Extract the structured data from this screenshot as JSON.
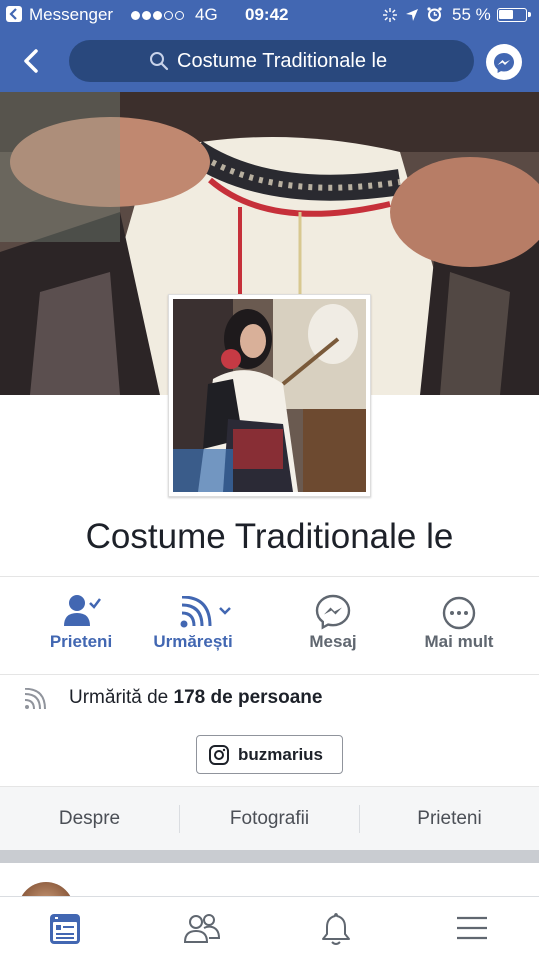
{
  "status_bar": {
    "carrier": "Messenger",
    "network": "4G",
    "time": "09:42",
    "battery_percent": "55 %",
    "signal_bars_filled": 3,
    "signal_bars_total": 5,
    "battery_level": 0.55
  },
  "nav": {
    "search_text": "Costume Traditionale le"
  },
  "page": {
    "name": "Costume Traditionale le"
  },
  "actions": [
    {
      "label": "Prieteni",
      "icon": "friends-check-icon",
      "active": true
    },
    {
      "label": "Urmărești",
      "icon": "follow-rss-icon",
      "active": true
    },
    {
      "label": "Mesaj",
      "icon": "messenger-icon",
      "active": false
    },
    {
      "label": "Mai mult",
      "icon": "more-icon",
      "active": false
    }
  ],
  "followers": {
    "prefix": "Urmărită de",
    "count_text": "178 de persoane"
  },
  "instagram": {
    "handle": "buzmarius"
  },
  "tabs": [
    {
      "label": "Despre"
    },
    {
      "label": "Fotografii"
    },
    {
      "label": "Prieteni"
    }
  ],
  "bottom_nav": [
    {
      "icon": "news-feed-icon",
      "active": true
    },
    {
      "icon": "friends-icon",
      "active": false
    },
    {
      "icon": "notifications-bell-icon",
      "active": false
    },
    {
      "icon": "menu-icon",
      "active": false
    }
  ],
  "colors": {
    "brand_blue": "#4267b2",
    "search_bg": "#29487d",
    "text_dark": "#1d2129",
    "text_gray": "#606770"
  }
}
